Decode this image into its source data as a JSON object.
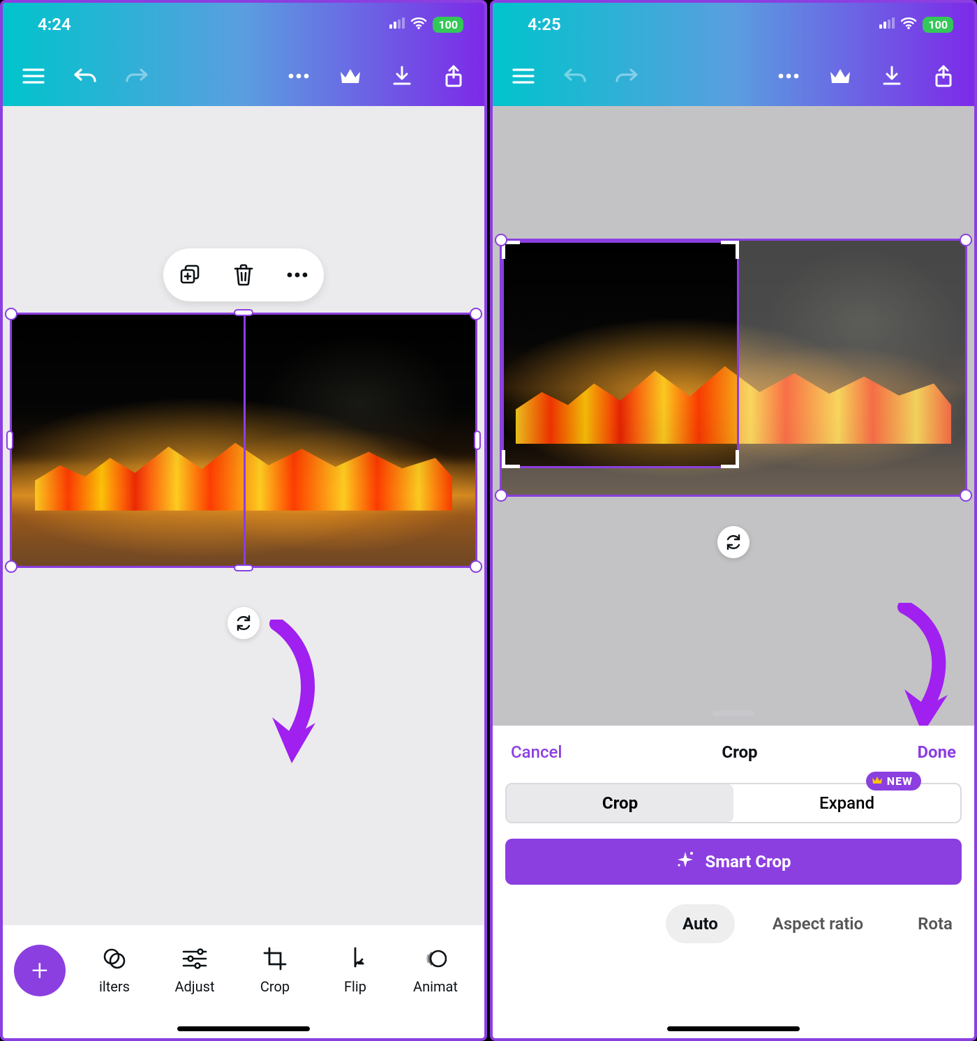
{
  "left": {
    "status": {
      "time": "4:24",
      "battery": "100"
    },
    "toolbar": {
      "menu": "menu",
      "undo": "undo",
      "redo": "redo",
      "more": "more",
      "premium": "premium",
      "download": "download",
      "share": "share"
    },
    "context_menu": {
      "duplicate": "duplicate",
      "delete": "delete",
      "more": "more"
    },
    "sync": "sync",
    "bottom_tools": [
      {
        "key": "filters",
        "label": "ilters"
      },
      {
        "key": "adjust",
        "label": "Adjust"
      },
      {
        "key": "crop",
        "label": "Crop"
      },
      {
        "key": "flip",
        "label": "Flip"
      },
      {
        "key": "animate",
        "label": "Animat"
      }
    ],
    "fab": "+"
  },
  "right": {
    "status": {
      "time": "4:25",
      "battery": "100"
    },
    "toolbar": {
      "menu": "menu",
      "undo": "undo",
      "redo": "redo",
      "more": "more",
      "premium": "premium",
      "download": "download",
      "share": "share"
    },
    "sync": "sync",
    "sheet": {
      "cancel": "Cancel",
      "title": "Crop",
      "done": "Done",
      "segment": {
        "crop": "Crop",
        "expand": "Expand",
        "new_badge": "NEW"
      },
      "smart_crop": "Smart Crop",
      "modes": {
        "auto": "Auto",
        "aspect": "Aspect ratio",
        "rotate": "Rota"
      }
    }
  },
  "colors": {
    "accent": "#8b3fe0",
    "gradient_start": "#00c4cc",
    "gradient_end": "#7d2ae8",
    "battery_green": "#34c759"
  }
}
